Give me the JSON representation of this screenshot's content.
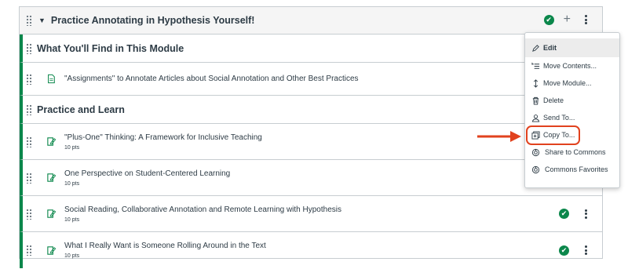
{
  "module": {
    "title": "Practice Annotating in Hypothesis Yourself!"
  },
  "sections": [
    {
      "type": "subheader",
      "label": "What You'll Find in This Module"
    },
    {
      "type": "page",
      "title": "\"Assignments\" to Annotate Articles about Social Annotation and Other Best Practices"
    },
    {
      "type": "subheader",
      "label": "Practice and Learn"
    }
  ],
  "items": [
    {
      "title": "\"Plus-One\" Thinking: A Framework for Inclusive Teaching",
      "points": "10 pts"
    },
    {
      "title": "One Perspective on Student-Centered Learning",
      "points": "10 pts"
    },
    {
      "title": "Social Reading, Collaborative Annotation and Remote Learning with Hypothesis",
      "points": "10 pts"
    },
    {
      "title": "What I Really Want is Someone Rolling Around in the Text",
      "points": "10 pts"
    }
  ],
  "menu": {
    "edit": "Edit",
    "move_contents": "Move Contents...",
    "move_module": "Move Module...",
    "delete": "Delete",
    "send_to": "Send To...",
    "copy_to": "Copy To...",
    "share_commons": "Share to Commons",
    "commons_favorites": "Commons Favorites"
  },
  "colors": {
    "published": "#0b874b",
    "highlight": "#e1421e"
  },
  "icons": {
    "published": "check-circle-icon",
    "add": "plus-icon",
    "more": "kebab-icon"
  }
}
